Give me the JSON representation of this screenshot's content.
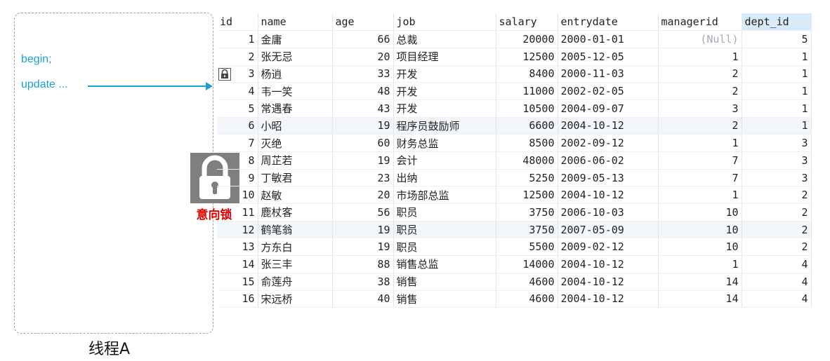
{
  "thread": {
    "line1": "begin;",
    "line2": "update ...",
    "label": "线程A"
  },
  "lock": {
    "caption": "意向锁",
    "icon": "lock-icon",
    "color": "#7f7f7f",
    "caption_color": "#e00000"
  },
  "table": {
    "columns": [
      "id",
      "name",
      "age",
      "job",
      "salary",
      "entrydate",
      "managerid",
      "dept_id"
    ],
    "highlight_column": "dept_id",
    "locked_row_id": "3",
    "rows": [
      [
        "1",
        "金庸",
        "66",
        "总裁",
        "20000",
        "2000-01-01",
        "(Null)",
        "5"
      ],
      [
        "2",
        "张无忌",
        "20",
        "项目经理",
        "12500",
        "2005-12-05",
        "1",
        "1"
      ],
      [
        "3",
        "杨逍",
        "33",
        "开发",
        "8400",
        "2000-11-03",
        "2",
        "1"
      ],
      [
        "4",
        "韦一笑",
        "48",
        "开发",
        "11000",
        "2002-02-05",
        "2",
        "1"
      ],
      [
        "5",
        "常遇春",
        "43",
        "开发",
        "10500",
        "2004-09-07",
        "3",
        "1"
      ],
      [
        "6",
        "小昭",
        "19",
        "程序员鼓励师",
        "6600",
        "2004-10-12",
        "2",
        "1"
      ],
      [
        "7",
        "灭绝",
        "60",
        "财务总监",
        "8500",
        "2002-09-12",
        "1",
        "3"
      ],
      [
        "8",
        "周芷若",
        "19",
        "会计",
        "48000",
        "2006-06-02",
        "7",
        "3"
      ],
      [
        "9",
        "丁敏君",
        "23",
        "出纳",
        "5250",
        "2009-05-13",
        "7",
        "3"
      ],
      [
        "10",
        "赵敏",
        "20",
        "市场部总监",
        "12500",
        "2004-10-12",
        "1",
        "2"
      ],
      [
        "11",
        "鹿杖客",
        "56",
        "职员",
        "3750",
        "2006-10-03",
        "10",
        "2"
      ],
      [
        "12",
        "鹤笔翁",
        "19",
        "职员",
        "3750",
        "2007-05-09",
        "10",
        "2"
      ],
      [
        "13",
        "方东白",
        "19",
        "职员",
        "5500",
        "2009-02-12",
        "10",
        "2"
      ],
      [
        "14",
        "张三丰",
        "88",
        "销售总监",
        "14000",
        "2004-10-12",
        "1",
        "4"
      ],
      [
        "15",
        "俞莲舟",
        "38",
        "销售",
        "4600",
        "2004-10-12",
        "14",
        "4"
      ],
      [
        "16",
        "宋远桥",
        "40",
        "销售",
        "4600",
        "2004-10-12",
        "14",
        "4"
      ]
    ]
  }
}
